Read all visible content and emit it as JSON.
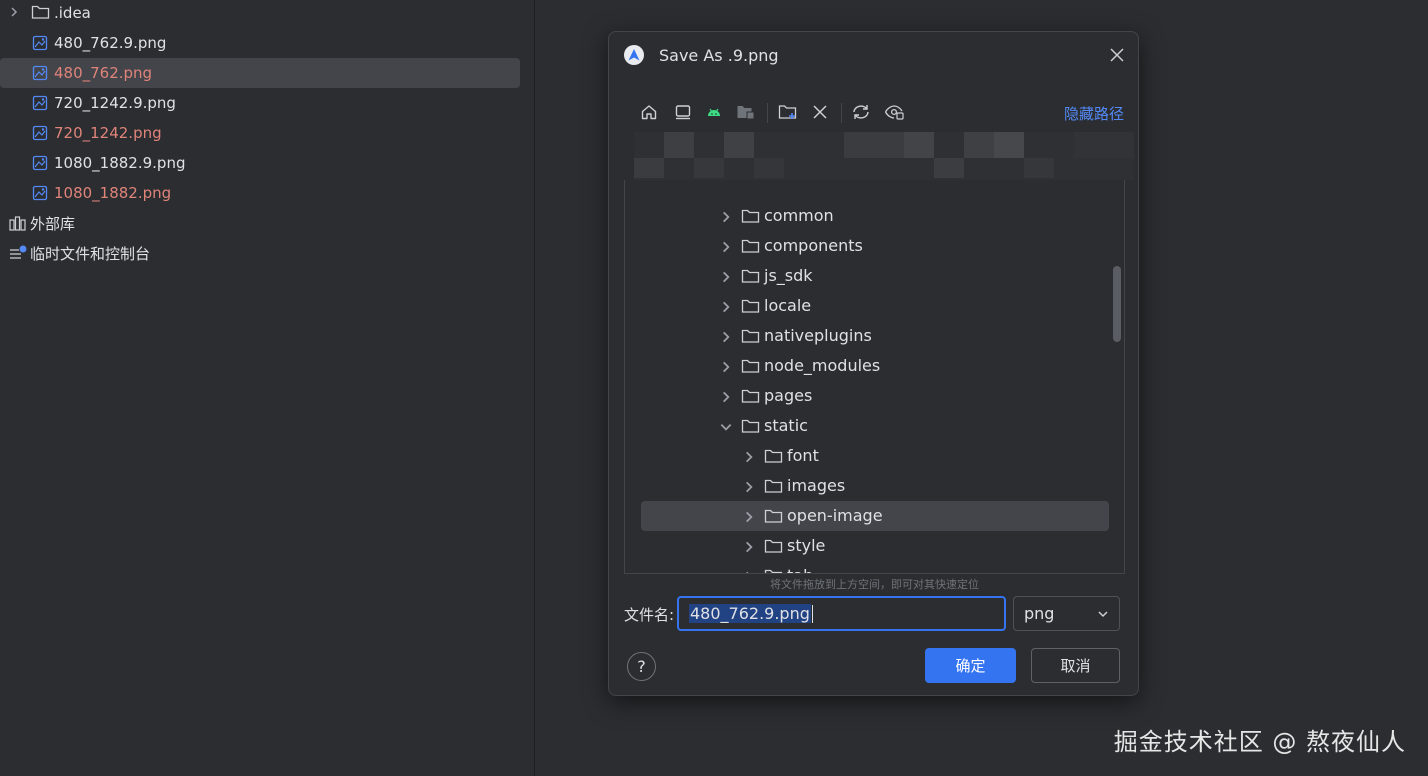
{
  "project_tree": {
    "items": [
      {
        "label": ".idea",
        "type": "folder",
        "color": "white"
      },
      {
        "label": "480_762.9.png",
        "type": "image",
        "color": "white"
      },
      {
        "label": "480_762.png",
        "type": "image",
        "color": "red"
      },
      {
        "label": "720_1242.9.png",
        "type": "image",
        "color": "white"
      },
      {
        "label": "720_1242.png",
        "type": "image",
        "color": "red"
      },
      {
        "label": "1080_1882.9.png",
        "type": "image",
        "color": "white"
      },
      {
        "label": "1080_1882.png",
        "type": "image",
        "color": "red"
      },
      {
        "label": "外部库",
        "type": "library",
        "color": "white"
      },
      {
        "label": "临时文件和控制台",
        "type": "scratch",
        "color": "white"
      }
    ]
  },
  "dialog": {
    "title": "Save As .9.png",
    "hide_path_label": "隐藏路径",
    "toolbar_icons": [
      "home-icon",
      "desktop-icon",
      "android-icon",
      "module-icon",
      "new-folder-icon",
      "delete-icon",
      "refresh-icon",
      "show-hidden-icon"
    ],
    "folders": [
      {
        "label": "common",
        "expanded": false
      },
      {
        "label": "components",
        "expanded": false
      },
      {
        "label": "js_sdk",
        "expanded": false
      },
      {
        "label": "locale",
        "expanded": false
      },
      {
        "label": "nativeplugins",
        "expanded": false
      },
      {
        "label": "node_modules",
        "expanded": false
      },
      {
        "label": "pages",
        "expanded": false
      },
      {
        "label": "static",
        "expanded": true
      },
      {
        "label": "font",
        "expanded": false
      },
      {
        "label": "images",
        "expanded": false
      },
      {
        "label": "open-image",
        "expanded": false,
        "selected": true
      },
      {
        "label": "style",
        "expanded": false
      },
      {
        "label": "tab",
        "expanded": false
      }
    ],
    "drag_hint": "将文件拖放到上方空间，即可对其快速定位",
    "filename_label": "文件名:",
    "filename_value": "480_762.9.png",
    "filetype_value": "png",
    "help_label": "?",
    "ok_label": "确定",
    "cancel_label": "取消"
  },
  "watermark": "掘金技术社区 @ 熬夜仙人",
  "colors": {
    "background": "#2b2d30",
    "accent": "#3574f0",
    "link": "#548af7",
    "modified_file": "#e0847a",
    "selection": "#43454a"
  }
}
